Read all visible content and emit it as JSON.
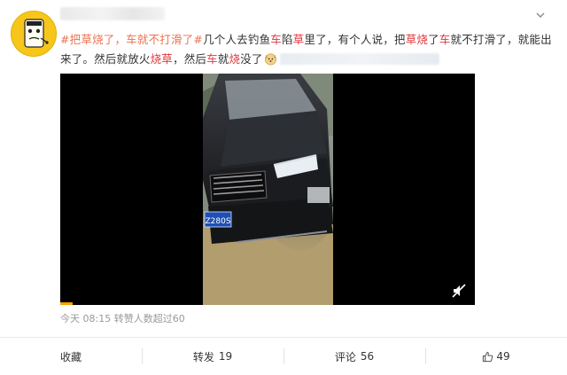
{
  "post": {
    "text_parts": {
      "topic1": "#把草烧了，车就不打滑了#",
      "seg1": "几个人去钓鱼",
      "hl_car1": "车",
      "seg2": "陷",
      "hl_grass1": "草",
      "seg3": "里了，有个人说，把",
      "hl_burn1": "草烧",
      "seg4": "了",
      "hl_car2": "车",
      "seg5": "就不打滑了，就能出来了。然后就放火",
      "hl_burn2": "烧草",
      "seg6": "，然后",
      "hl_car3": "车",
      "seg7": "就",
      "hl_burn3": "烧",
      "seg8": "没了"
    },
    "meta_text": "今天 08:15 转赞人数超过60"
  },
  "video": {
    "plate_text": "Z280S"
  },
  "actions": {
    "favorite_label": "收藏",
    "repost_label": "转发",
    "repost_count": "19",
    "comment_label": "评论",
    "comment_count": "56",
    "like_count": "49"
  },
  "colors": {
    "topic": "#eb7350",
    "highlight": "#e0393e",
    "meta": "#999999",
    "progress": "#f3a600"
  },
  "icons": [
    "avatar",
    "chevron-down-icon",
    "dog-emoji-icon",
    "mute-icon",
    "thumbs-up-icon"
  ]
}
